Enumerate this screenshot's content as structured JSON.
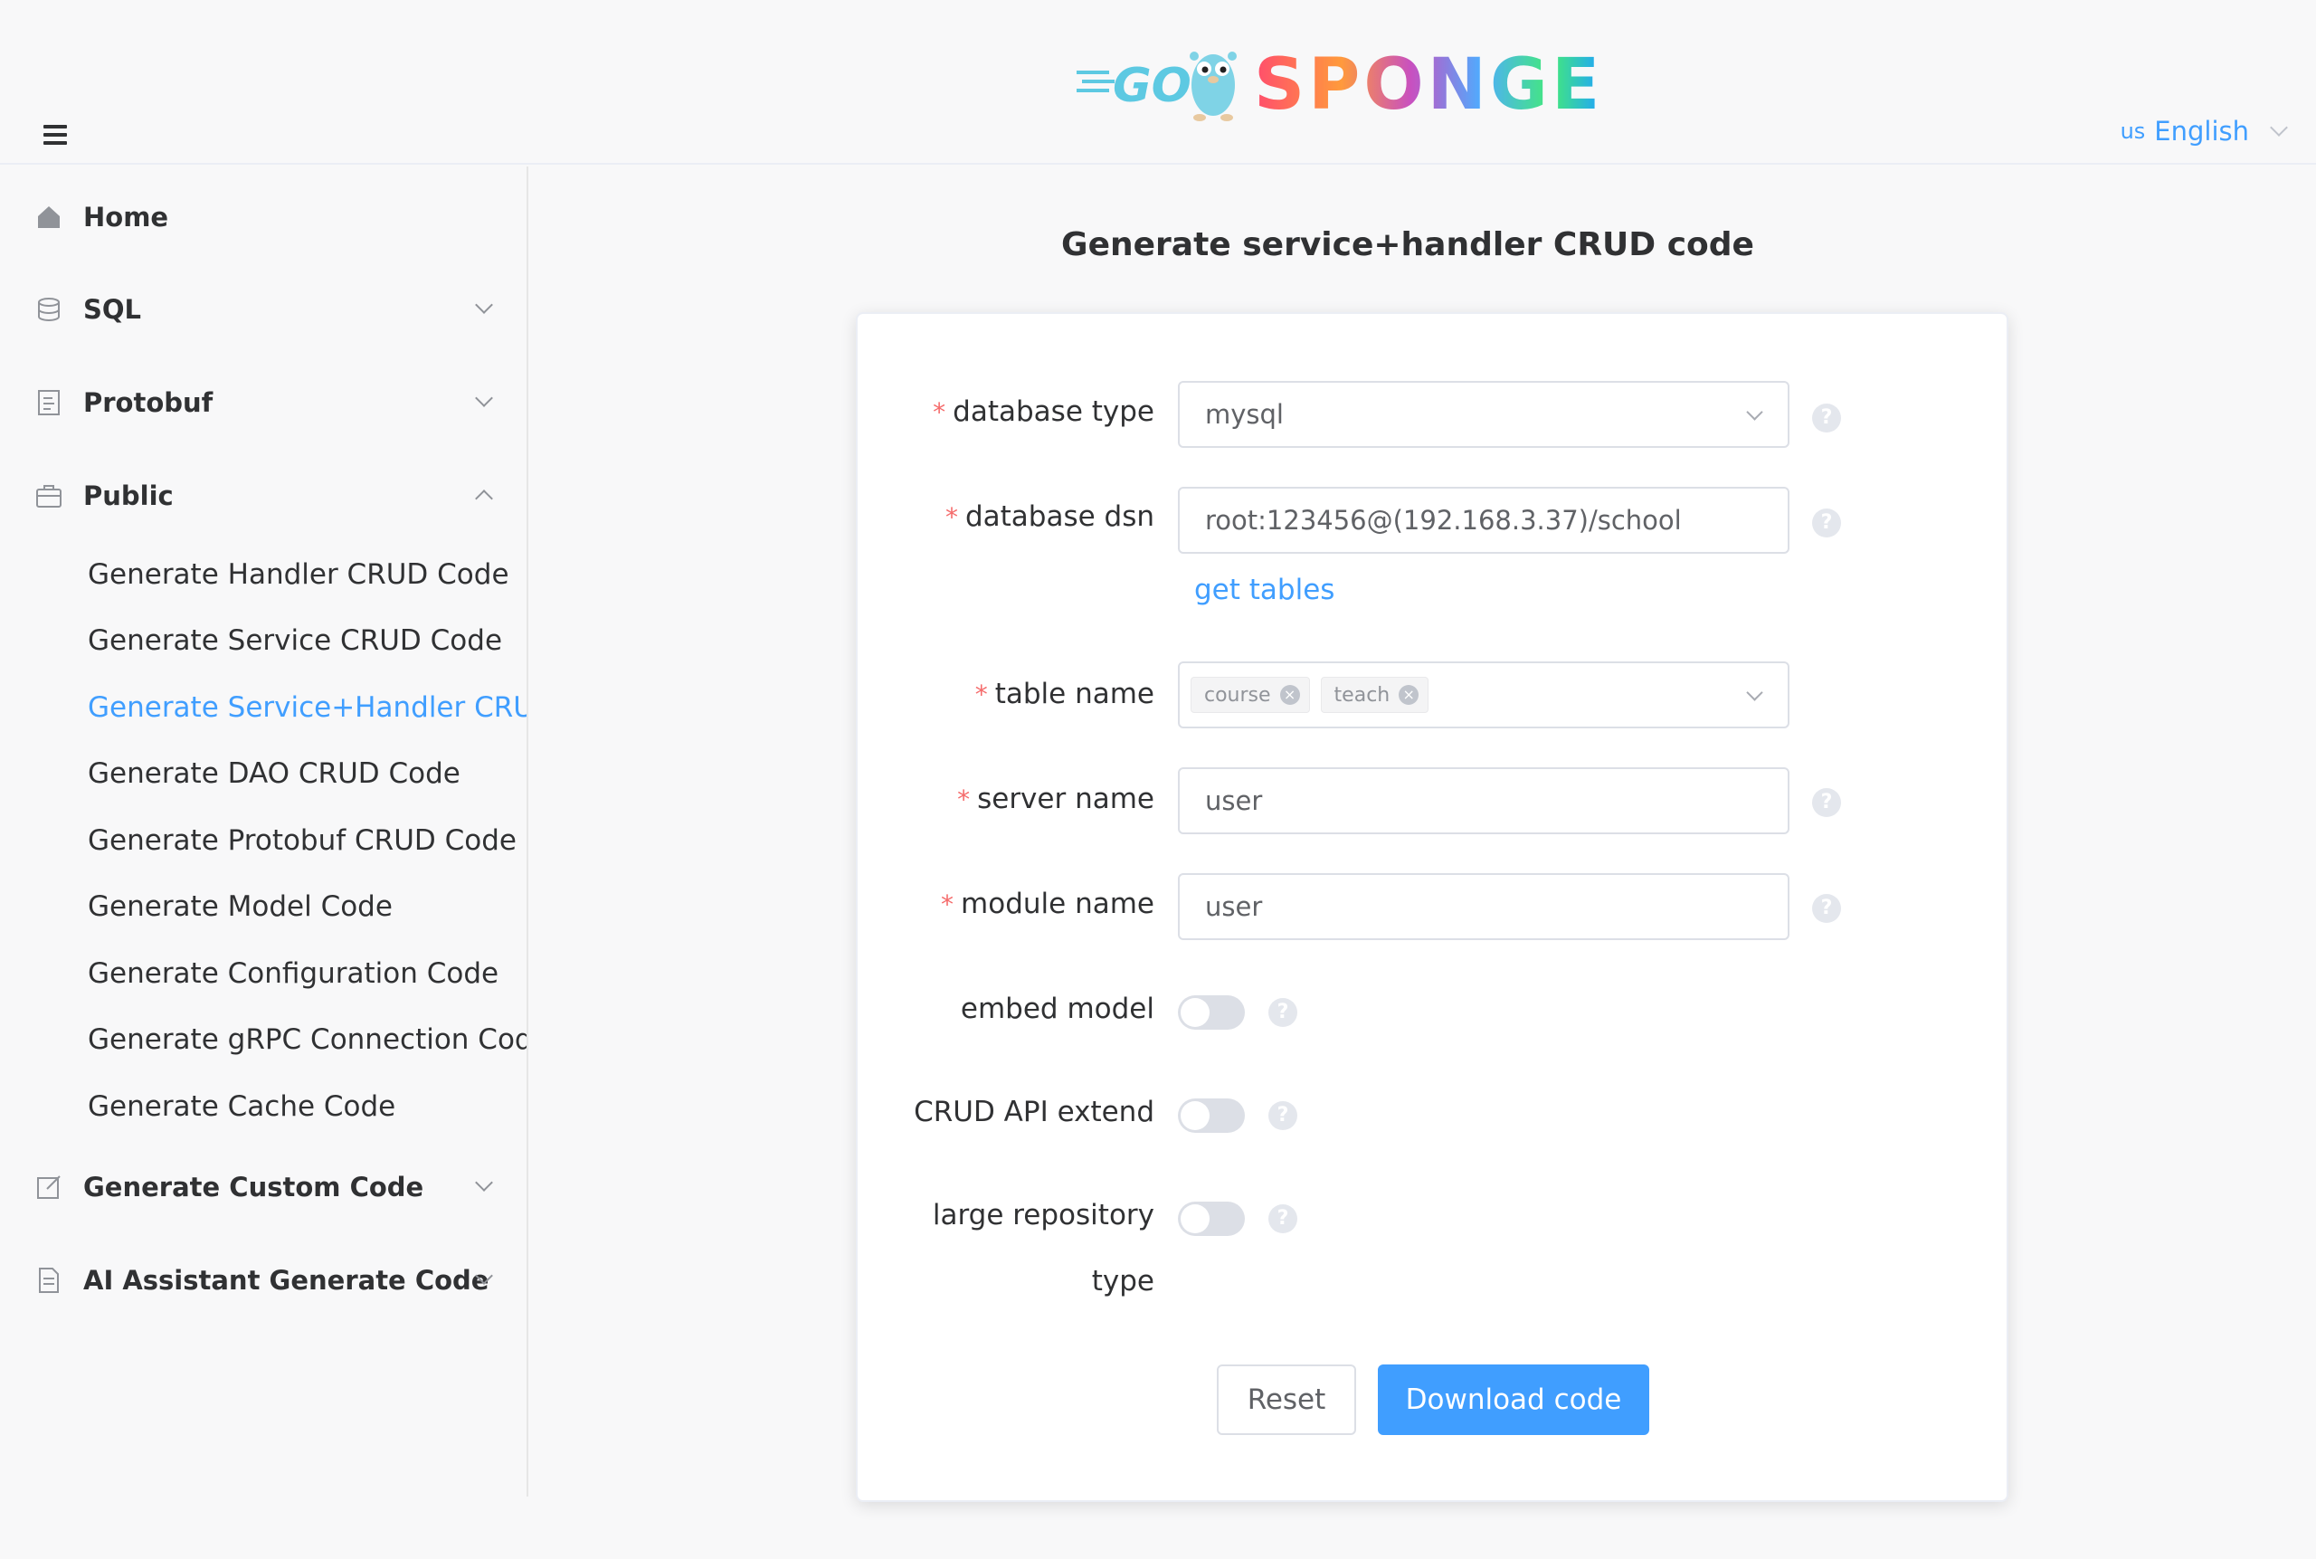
{
  "header": {
    "logo_alt": "GO SPONGE",
    "language": {
      "flag": "us",
      "label": "English"
    }
  },
  "sidebar": {
    "items": [
      {
        "label": "Home",
        "icon": "home-icon"
      },
      {
        "label": "SQL",
        "icon": "database-icon",
        "expanded": false
      },
      {
        "label": "Protobuf",
        "icon": "document-icon",
        "expanded": false
      },
      {
        "label": "Public",
        "icon": "briefcase-icon",
        "expanded": true
      },
      {
        "label": "Generate Custom Code",
        "icon": "edit-icon",
        "expanded": false
      },
      {
        "label": "AI Assistant Generate Code",
        "icon": "file-icon",
        "expanded": false
      }
    ],
    "public_children": [
      {
        "label": "Generate Handler CRUD Code"
      },
      {
        "label": "Generate Service CRUD Code"
      },
      {
        "label": "Generate Service+Handler CRUD Code",
        "active": true
      },
      {
        "label": "Generate DAO CRUD Code"
      },
      {
        "label": "Generate Protobuf CRUD Code"
      },
      {
        "label": "Generate Model Code"
      },
      {
        "label": "Generate Configuration Code"
      },
      {
        "label": "Generate gRPC Connection Code"
      },
      {
        "label": "Generate Cache Code"
      }
    ]
  },
  "main": {
    "title": "Generate service+handler CRUD code",
    "form": {
      "database_type": {
        "label": "database type",
        "value": "mysql",
        "required": true
      },
      "database_dsn": {
        "label": "database dsn",
        "value": "root:123456@(192.168.3.37)/school",
        "required": true
      },
      "get_tables_link": "get tables",
      "table_name": {
        "label": "table name",
        "tags": [
          "course",
          "teach"
        ],
        "required": true
      },
      "server_name": {
        "label": "server name",
        "value": "user",
        "required": true
      },
      "module_name": {
        "label": "module name",
        "value": "user",
        "required": true
      },
      "embed_model": {
        "label": "embed model",
        "on": false
      },
      "crud_api_extend": {
        "label": "CRUD API extend",
        "on": false
      },
      "large_repository": {
        "label_line1": "large repository",
        "label_line2": "type",
        "on": false
      }
    },
    "buttons": {
      "reset": "Reset",
      "download": "Download code"
    }
  },
  "colors": {
    "accent": "#409eff",
    "required": "#f56c6c",
    "text": "#303133"
  }
}
